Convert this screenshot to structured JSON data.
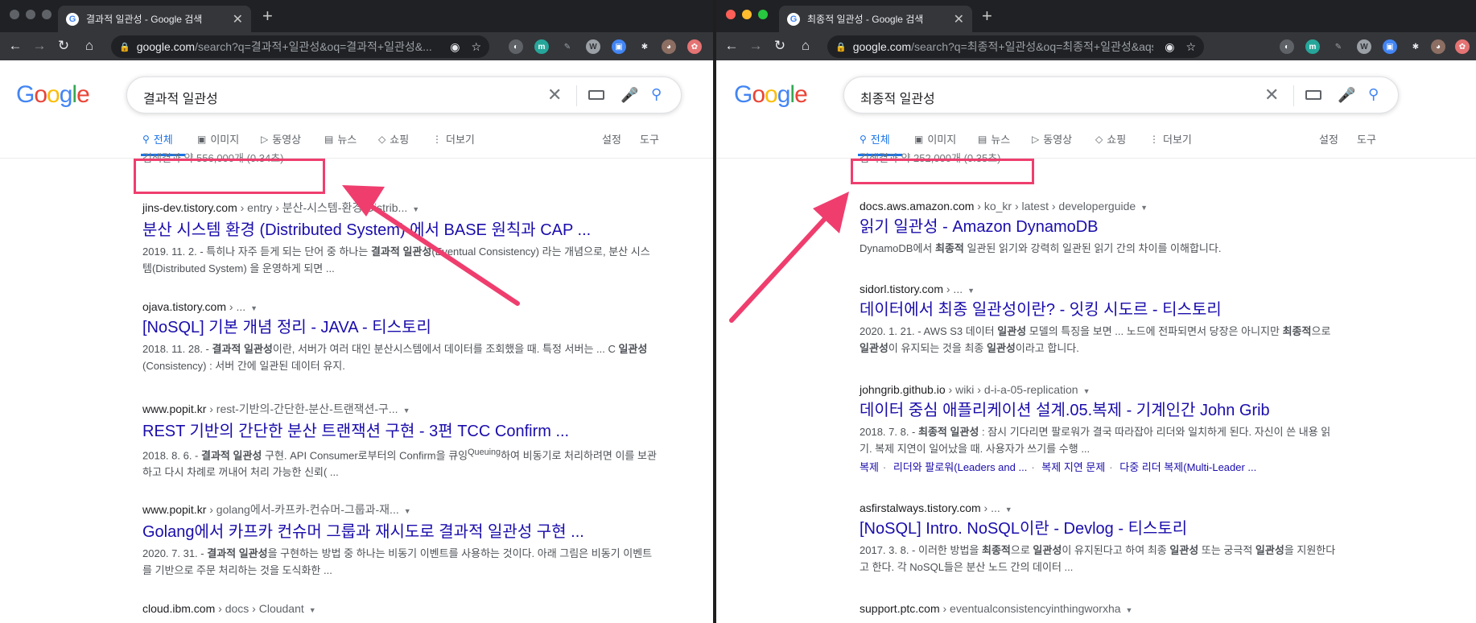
{
  "left": {
    "tab_title": "결과적 일관성 - Google 검색",
    "url_host": "google.com",
    "url_rest": "/search?q=결과적+일관성&oq=결과적+일관성&...",
    "search_query": "결과적 일관성",
    "nav_tabs": [
      "전체",
      "이미지",
      "동영상",
      "뉴스",
      "쇼핑",
      "더보기"
    ],
    "settings_label": "설정",
    "tools_label": "도구",
    "result_stats": "검색결과 약 556,000개 (0.34초)",
    "results": [
      {
        "host": "jins-dev.tistory.com",
        "path": " › entry › 분산-시스템-환경-Distrib...",
        "title": "분산 시스템 환경 (Distributed System) 에서 BASE 원칙과 CAP ...",
        "snippet_html": "2019. 11. 2. - 특히나 자주 듣게 되는 단어 중 하나는 <b>결과적 일관성</b>(Eventual Consistency) 라는 개념으로, 분산 시스템(Distributed System) 을 운영하게 되면 ..."
      },
      {
        "host": "ojava.tistory.com",
        "path": " › ...",
        "title": "[NoSQL] 기본 개념 정리 - JAVA - 티스토리",
        "snippet_html": "2018. 11. 28. - <b>결과적 일관성</b>이란, 서버가 여러 대인 분산시스템에서 데이터를 조회했을 때. 특정 서버는 ... C <b>일관성</b> (Consistency) : 서버 간에 일관된 데이터 유지."
      },
      {
        "host": "www.popit.kr",
        "path": " › rest-기반의-간단한-분산-트랜잭션-구...",
        "title": "REST 기반의 간단한 분산 트랜잭션 구현 - 3편 TCC Confirm ...",
        "snippet_html": "2018. 8. 6. - <b>결과적 일관성</b> 구현. API Consumer로부터의 Confirm을 큐잉<sup>Queuing</sup>하여 비동기로 처리하려면 이를 보관하고 다시 차례로 꺼내어 처리 가능한 신뢰( ..."
      },
      {
        "host": "www.popit.kr",
        "path": " › golang에서-카프카-컨슈머-그룹과-재...",
        "title": "Golang에서 카프카 컨슈머 그룹과 재시도로 결과적 일관성 구현 ...",
        "snippet_html": "2020. 7. 31. - <b>결과적 일관성</b>을 구현하는 방법 중 하나는 비동기 이벤트를 사용하는 것이다. 아래 그림은 비동기 이벤트를 기반으로 주문 처리하는 것을 도식화한 ..."
      },
      {
        "host": "cloud.ibm.com",
        "path": " › docs › Cloudant",
        "title": "",
        "snippet_html": ""
      }
    ]
  },
  "right": {
    "tab_title": "최종적 일관성 - Google 검색",
    "url_host": "google.com",
    "url_rest": "/search?q=최종적+일관성&oq=최종적+일관성&aqs=chro...",
    "search_query": "최종적 일관성",
    "nav_tabs": [
      "전체",
      "이미지",
      "뉴스",
      "동영상",
      "쇼핑",
      "더보기"
    ],
    "settings_label": "설정",
    "tools_label": "도구",
    "result_stats": "검색결과 약 252,000개 (0.35초)",
    "results": [
      {
        "host": "docs.aws.amazon.com",
        "path": " › ko_kr › latest › developerguide",
        "title": "읽기 일관성 - Amazon DynamoDB",
        "snippet_html": "DynamoDB에서 <b>최종적</b> 일관된 읽기와 강력히 일관된 읽기 간의 차이를 이해합니다."
      },
      {
        "host": "sidorl.tistory.com",
        "path": " › ...",
        "title": "데이터에서 최종 일관성이란? - 잇킹 시도르 - 티스토리",
        "snippet_html": "2020. 1. 21. - AWS S3 데이터 <b>일관성</b> 모델의 특징을 보면 ... 노드에 전파되면서 당장은 아니지만 <b>최종적</b>으로 <b>일관성</b>이 유지되는 것을 최종 <b>일관성</b>이라고 합니다."
      },
      {
        "host": "johngrib.github.io",
        "path": " › wiki › d-i-a-05-replication",
        "title": "데이터 중심 애플리케이션 설계.05.복제 - 기계인간 John Grib",
        "snippet_html": "2018. 7. 8. - <b>최종적 일관성</b> : 잠시 기다리면 팔로워가 결국 따라잡아 리더와 일치하게 된다. 자신이 쓴 내용 읽기. 복제 지연이 일어났을 때. 사용자가 쓰기를 수행 ...",
        "sitelinks": [
          "복제",
          "리더와 팔로워(Leaders and ...",
          "복제 지연 문제",
          "다중 리더 복제(Multi-Leader ..."
        ]
      },
      {
        "host": "asfirstalways.tistory.com",
        "path": " › ...",
        "title": "[NoSQL] Intro. NoSQL이란 - Devlog - 티스토리",
        "snippet_html": "2017. 3. 8. - 이러한 방법을 <b>최종적</b>으로 <b>일관성</b>이 유지된다고 하여 최종 <b>일관성</b> 또는 궁극적 <b>일관성</b>을 지원한다고 한다. 각 NoSQL들은 분산 노드 간의 데이터 ..."
      },
      {
        "host": "support.ptc.com",
        "path": " › eventualconsistencyinthingworxha",
        "title": "",
        "snippet_html": ""
      }
    ]
  },
  "colors": {
    "highlight": "#ef3e6e",
    "link": "#1a0dab",
    "accent": "#1a73e8"
  }
}
